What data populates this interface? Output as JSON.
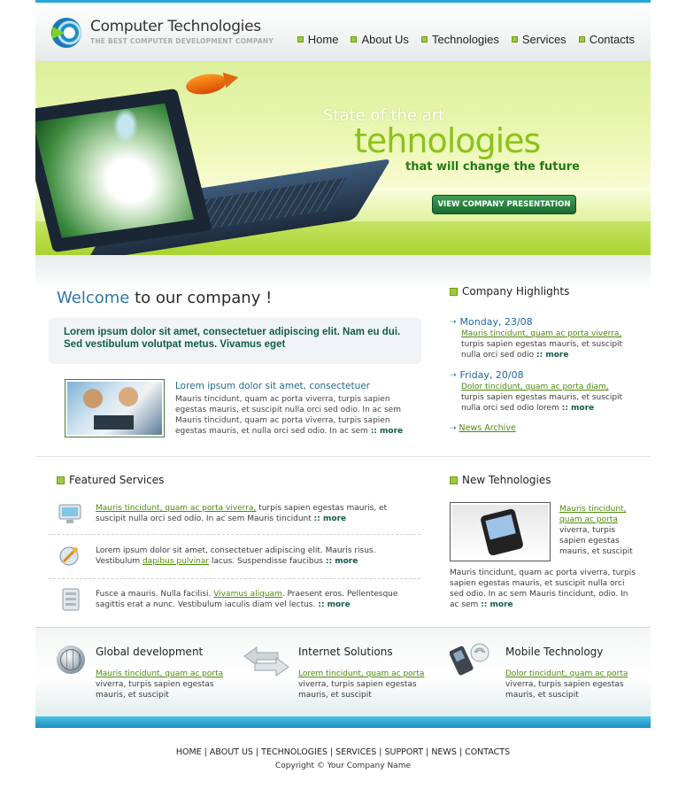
{
  "brand": {
    "name": "Computer Technologies",
    "tagline": "THE BEST COMPUTER DEVELOPMENT COMPANY"
  },
  "nav": [
    {
      "label": "Home"
    },
    {
      "label": "About Us"
    },
    {
      "label": "Technologies"
    },
    {
      "label": "Services"
    },
    {
      "label": "Contacts"
    }
  ],
  "banner": {
    "line1": "State of the art",
    "line2": "tehnologies",
    "line3": "that will change the future",
    "cta": "VIEW COMPANY PRESENTATION"
  },
  "welcome": {
    "highlight": "Welcome",
    "rest": " to our company !",
    "intro": "Lorem ipsum dolor sit amet, consectetuer adipiscing elit. Nam eu dui. Sed vestibulum volutpat metus. Vivamus eget",
    "article_title": "Lorem ipsum dolor sit amet, consectetuer",
    "article_body": "Mauris tincidunt, quam ac porta viverra, turpis sapien egestas mauris, et suscipit nulla orci sed odio. In ac sem Mauris tincidunt, quam ac porta viverra, turpis sapien egestas mauris, et nulla orci sed odio. In ac sem",
    "more": "more"
  },
  "highlights": {
    "title": "Company Highlights",
    "items": [
      {
        "date": "Monday, 23/08",
        "link": "Mauris tincidunt, quam ac porta viverra,",
        "text": "turpis sapien egestas mauris, et suscipit nulla orci sed odio",
        "more": "more"
      },
      {
        "date": "Friday, 20/08",
        "link": "Dolor tincidunt, quam ac porta diam,",
        "text": "turpis sapien egestas mauris, et suscipit nulla orci sed odio lorem",
        "more": "more"
      }
    ],
    "archive": "News Archive"
  },
  "services": {
    "title": "Featured Services",
    "items": [
      {
        "link": "Mauris tincidunt, quam ac porta viverra,",
        "pre": "",
        "text": " turpis sapien egestas mauris, et suscipit nulla orci sed odio. In ac sem Mauris tincidunt",
        "more": "more"
      },
      {
        "pre": "Lorem ipsum dolor sit amet, consectetuer adipiscing elit. Mauris risus. Vestibulum ",
        "link": "dapibus pulvinar",
        "text": " lacus. Suspendisse faucibus",
        "more": "more"
      },
      {
        "pre": "Fusce a mauris. Nulla facilisi. ",
        "link": "Vivamus aliquam",
        "text": ". Praesent eros. Pellentesque sagittis erat a nunc. Vestibulum iaculis diam vel lectus.",
        "more": "more"
      }
    ]
  },
  "new_tech": {
    "title": "New Tehnologies",
    "link": "Mauris tincidunt, quam ac porta",
    "side_text": "viverra, turpis sapien egestas mauris, et suscipit",
    "body": "Mauris tincidunt, quam ac porta viverra, turpis sapien egestas mauris, et suscipit nulla orci sed odio. In ac sem Mauris tincidunt, odio. In ac sem",
    "more": "more"
  },
  "bottom": [
    {
      "title": "Global development",
      "link": "Mauris tincidunt, quam ac porta",
      "text": "viverra, turpis sapien egestas mauris, et suscipit"
    },
    {
      "title": "Internet Solutions",
      "link": "Lorem tincidunt, quam ac porta",
      "text": "viverra, turpis sapien egestas mauris, et suscipit"
    },
    {
      "title": "Mobile Technology",
      "link": "Dolor tincidunt, quam ac porta",
      "text": "viverra, turpis sapien egestas mauris, et suscipit"
    }
  ],
  "footer": {
    "links": [
      "HOME",
      "ABOUT US",
      "TECHNOLOGIES",
      "SERVICES",
      "SUPPORT",
      "NEWS",
      "CONTACTS"
    ],
    "copyright": "Copyright © Your Company Name"
  },
  "colors": {
    "accent": "#25a8d6",
    "green": "#9ec83d",
    "link": "#4e8a0d",
    "dark_green": "#0f5f44"
  }
}
